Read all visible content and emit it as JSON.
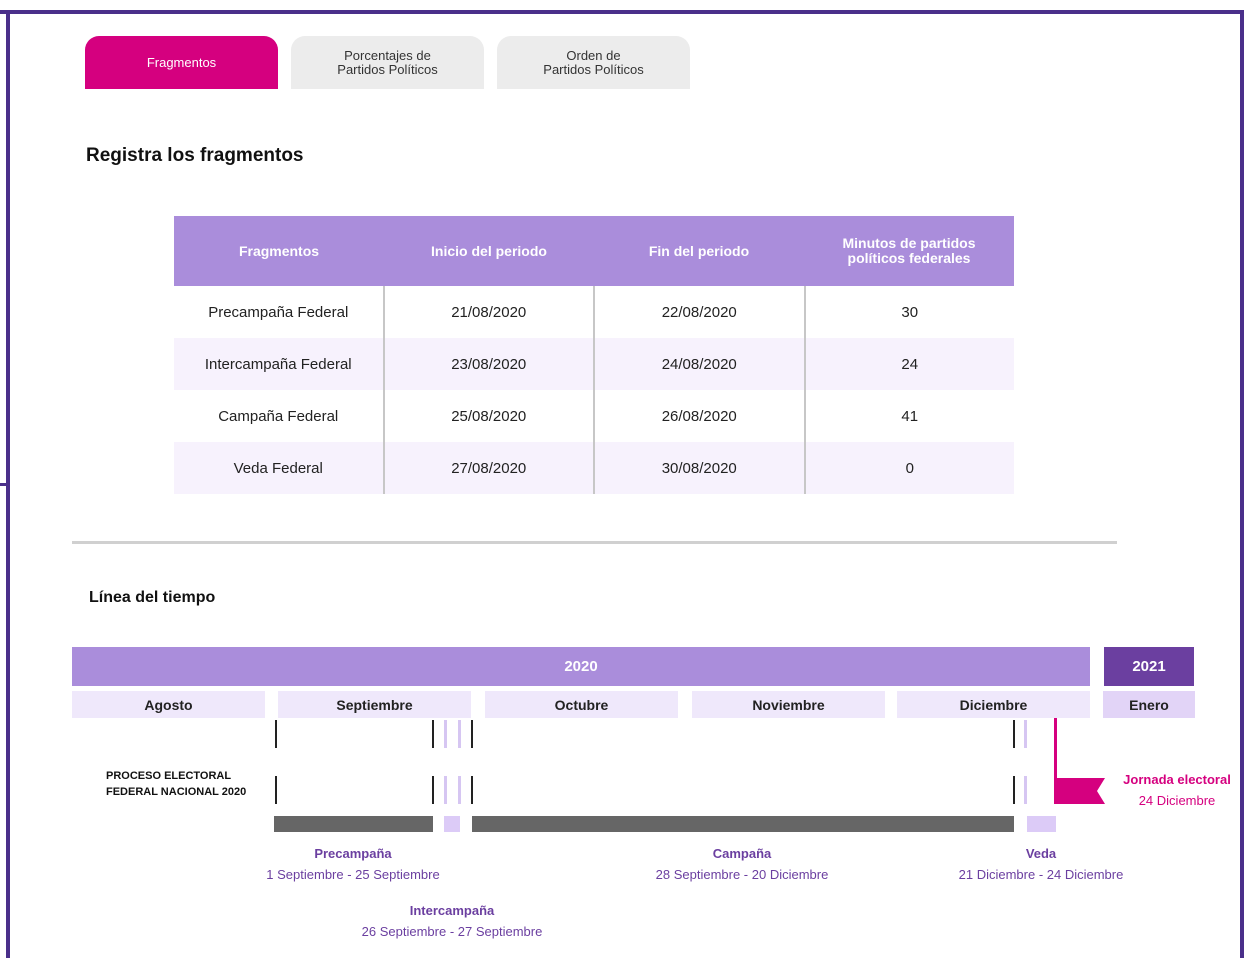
{
  "tabs": [
    {
      "line1": "Fragmentos",
      "line2": "",
      "active": true
    },
    {
      "line1": "Porcentajes de",
      "line2": "Partidos Políticos",
      "active": false
    },
    {
      "line1": "Orden de",
      "line2": "Partidos Políticos",
      "active": false
    }
  ],
  "section_title": "Registra los fragmentos",
  "table": {
    "headers": [
      "Fragmentos",
      "Inicio del periodo",
      "Fin del periodo",
      "Minutos de partidos políticos federales"
    ],
    "rows": [
      [
        "Precampaña Federal",
        "21/08/2020",
        "22/08/2020",
        "30"
      ],
      [
        "Intercampaña Federal",
        "23/08/2020",
        "24/08/2020",
        "24"
      ],
      [
        "Campaña Federal",
        "25/08/2020",
        "26/08/2020",
        "41"
      ],
      [
        "Veda Federal",
        "27/08/2020",
        "30/08/2020",
        "0"
      ]
    ]
  },
  "timeline": {
    "title": "Línea del tiempo",
    "years": {
      "y2020": "2020",
      "y2021": "2021"
    },
    "months": [
      "Agosto",
      "Septiembre",
      "Octubre",
      "Noviembre",
      "Diciembre",
      "Enero"
    ],
    "process_label_line1": "PROCESO ELECTORAL",
    "process_label_line2": "FEDERAL NACIONAL 2020",
    "captions": {
      "precampana": {
        "title": "Precampaña",
        "range": "1 Septiembre - 25 Septiembre"
      },
      "intercampana": {
        "title": "Intercampaña",
        "range": "26 Septiembre - 27 Septiembre"
      },
      "campana": {
        "title": "Campaña",
        "range": "28 Septiembre - 20 Diciembre"
      },
      "veda": {
        "title": "Veda",
        "range": "21 Diciembre - 24 Diciembre"
      },
      "jornada": {
        "title": "Jornada electoral",
        "range": "24 Diciembre"
      }
    }
  },
  "colors": {
    "accent_magenta": "#d5007f",
    "purple_light": "#aa8ddb",
    "purple_dark": "#6b3fa0",
    "frame_purple": "#4a2f8a"
  },
  "icons": {
    "flag": "flag-icon"
  }
}
